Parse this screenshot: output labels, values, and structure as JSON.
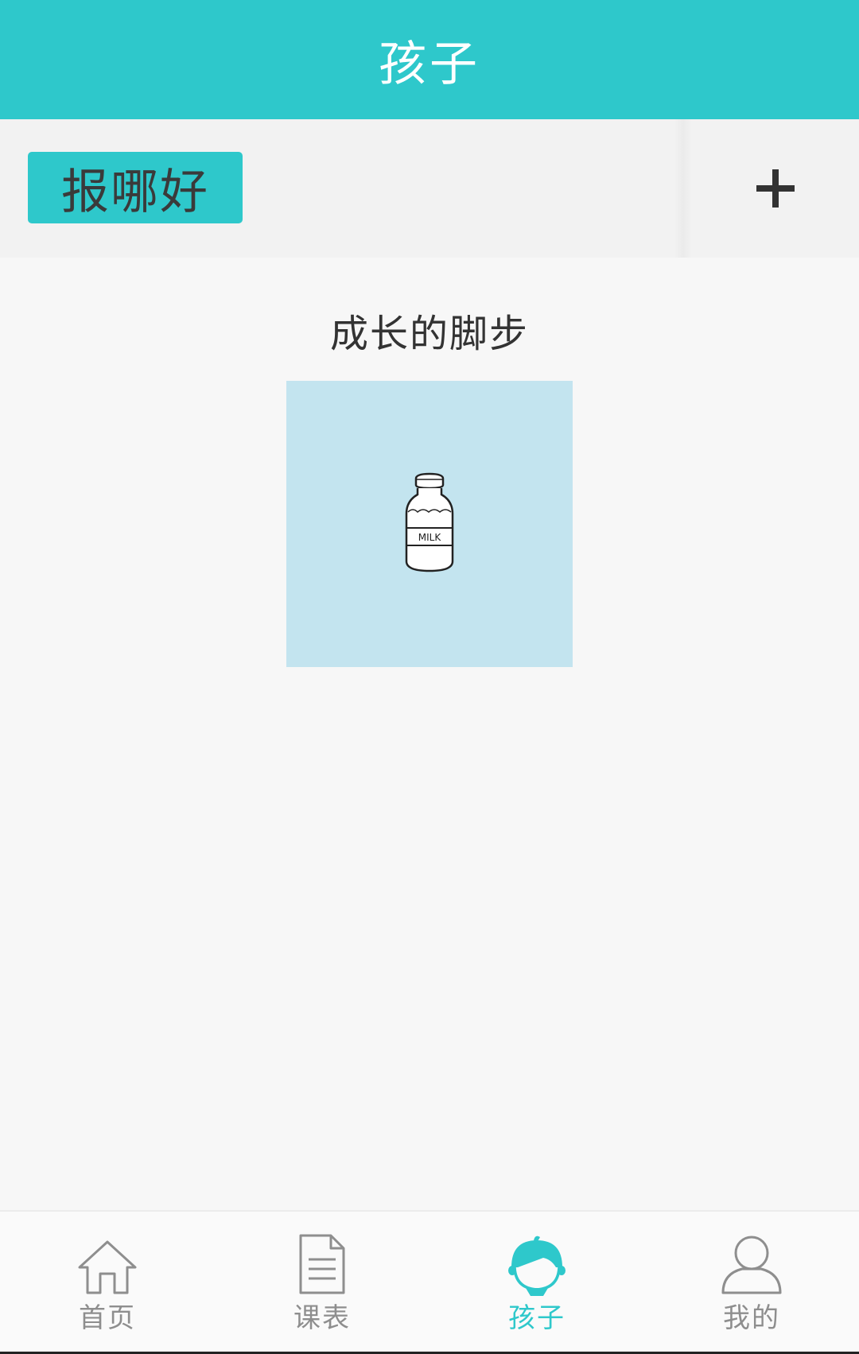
{
  "colors": {
    "accent": "#2ec8cb",
    "card_bg": "#c3e4ef",
    "tab_inactive": "#8e8e8e",
    "tab_active": "#2ec8cb",
    "text_dark": "#333333"
  },
  "header": {
    "title": "孩子"
  },
  "kid_bar": {
    "selected_kid": "报哪好",
    "add_icon": "plus-icon"
  },
  "main": {
    "section_title": "成长的脚步",
    "growth_card": {
      "icon": "milk-bottle-icon",
      "label": "MILK"
    }
  },
  "tabbar": {
    "active_index": 2,
    "tabs": [
      {
        "label": "首页",
        "icon": "home-icon"
      },
      {
        "label": "课表",
        "icon": "document-icon"
      },
      {
        "label": "孩子",
        "icon": "child-icon"
      },
      {
        "label": "我的",
        "icon": "user-icon"
      }
    ]
  }
}
